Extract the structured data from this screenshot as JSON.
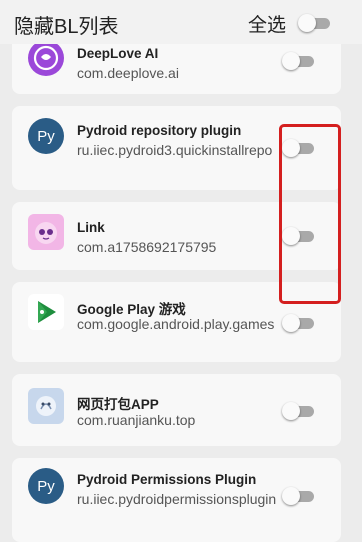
{
  "header": {
    "title": "隐藏BL列表",
    "select_all_label": "全选"
  },
  "apps": [
    {
      "name": "DeepLove AI",
      "package": "com.deeplove.ai",
      "icon": "deeplove-icon",
      "enabled": false
    },
    {
      "name": "Pydroid repository plugin",
      "package": "ru.iiec.pydroid3.quickinstallrepo",
      "icon": "pydroid-icon",
      "enabled": false
    },
    {
      "name": "Link",
      "package": "com.a1758692175795",
      "icon": "link-app-icon",
      "enabled": false
    },
    {
      "name": "Google Play 游戏",
      "package": "com.google.android.play.games",
      "icon": "google-play-games-icon",
      "enabled": false
    },
    {
      "name": "网页打包APP",
      "package": "com.ruanjianku.top",
      "icon": "web-package-app-icon",
      "enabled": false
    },
    {
      "name": "Pydroid Permissions Plugin",
      "package": "ru.iiec.pydroidpermissionsplugin",
      "icon": "pydroid-icon",
      "enabled": false
    }
  ],
  "colors": {
    "annotation": "#d41f1f",
    "toggle_off_track": "#a9a9a9"
  }
}
